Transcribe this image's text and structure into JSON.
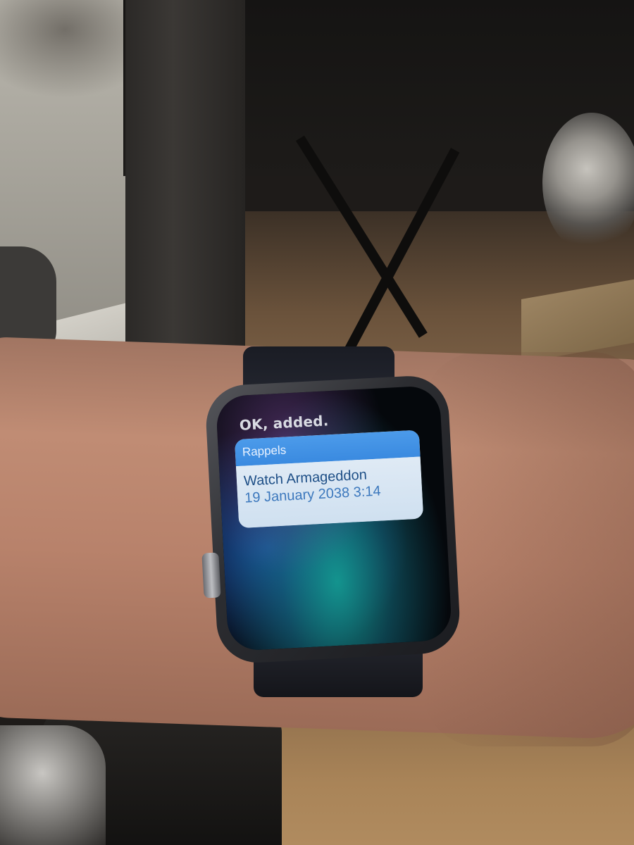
{
  "watch": {
    "status": "OK, added.",
    "reminder_card": {
      "app_name": "Rappels",
      "title": "Watch Armageddon",
      "date": "19 January 2038 3:14"
    }
  },
  "colors": {
    "card_header": "#3a8ae0",
    "card_body": "#d9e7f3",
    "title_text": "#1d4e86",
    "date_text": "#3c78bd"
  }
}
